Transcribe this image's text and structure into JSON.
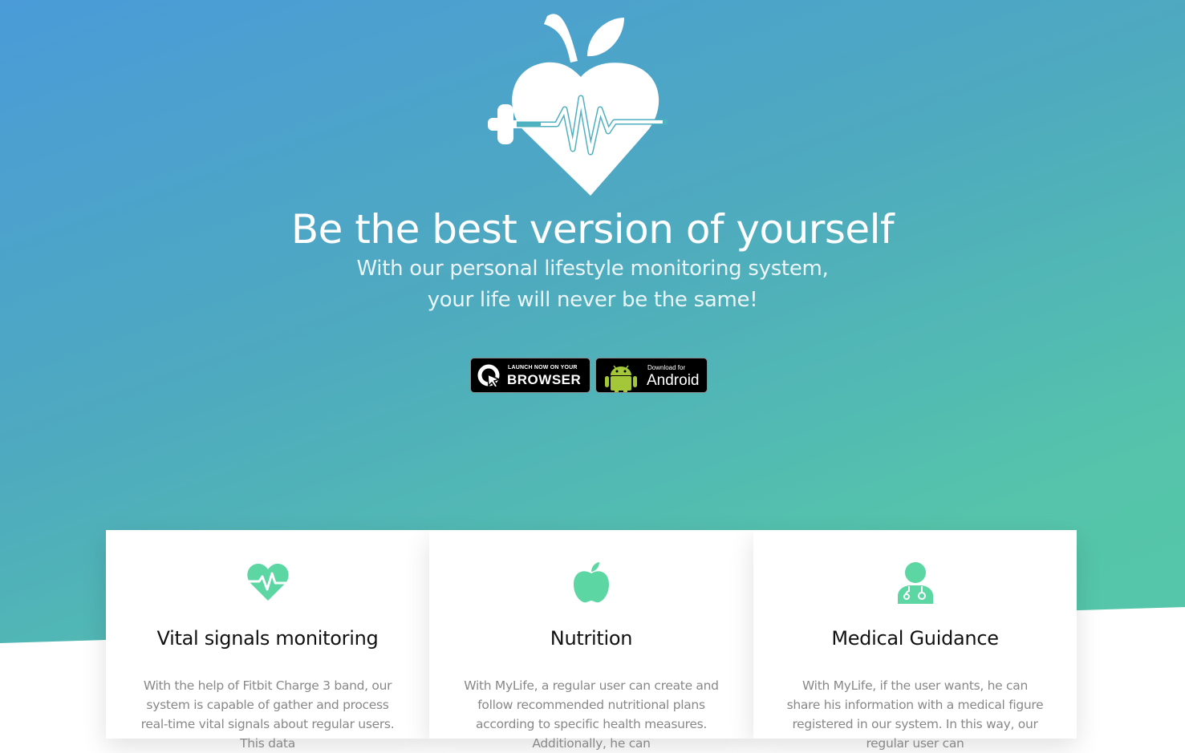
{
  "hero": {
    "headline": "Be the best version of yourself",
    "subtitle_line1": "With our personal lifestyle monitoring system,",
    "subtitle_line2": "your life will never be the same!",
    "logo_icon": "heart-apple-dumbbell-pulse-logo",
    "gradient_colors": [
      "#4a9bd8",
      "#4eaabf",
      "#55c4ab",
      "#56c8a8"
    ]
  },
  "buttons": {
    "browser": {
      "small_label": "LAUNCH NOW ON YOUR",
      "label": "BROWSER",
      "icon": "browser-cursor-icon"
    },
    "android": {
      "small_label": "Download for",
      "label": "Android",
      "icon": "android-icon"
    }
  },
  "accent_color": "#5cd6a3",
  "features": [
    {
      "icon": "heart-pulse-icon",
      "title": "Vital signals monitoring",
      "text": "With the help of Fitbit Charge 3 band, our system is capable of gather and process real-time vital signals about regular users. This data"
    },
    {
      "icon": "apple-icon",
      "title": "Nutrition",
      "text": "With MyLife, a regular user can create and follow recommended nutritional plans according to specific health measures. Additionally, he can"
    },
    {
      "icon": "doctor-icon",
      "title": "Medical Guidance",
      "text": "With MyLife, if the user wants, he can share his information with a medical figure registered in our system. In this way, our regular user can"
    }
  ]
}
